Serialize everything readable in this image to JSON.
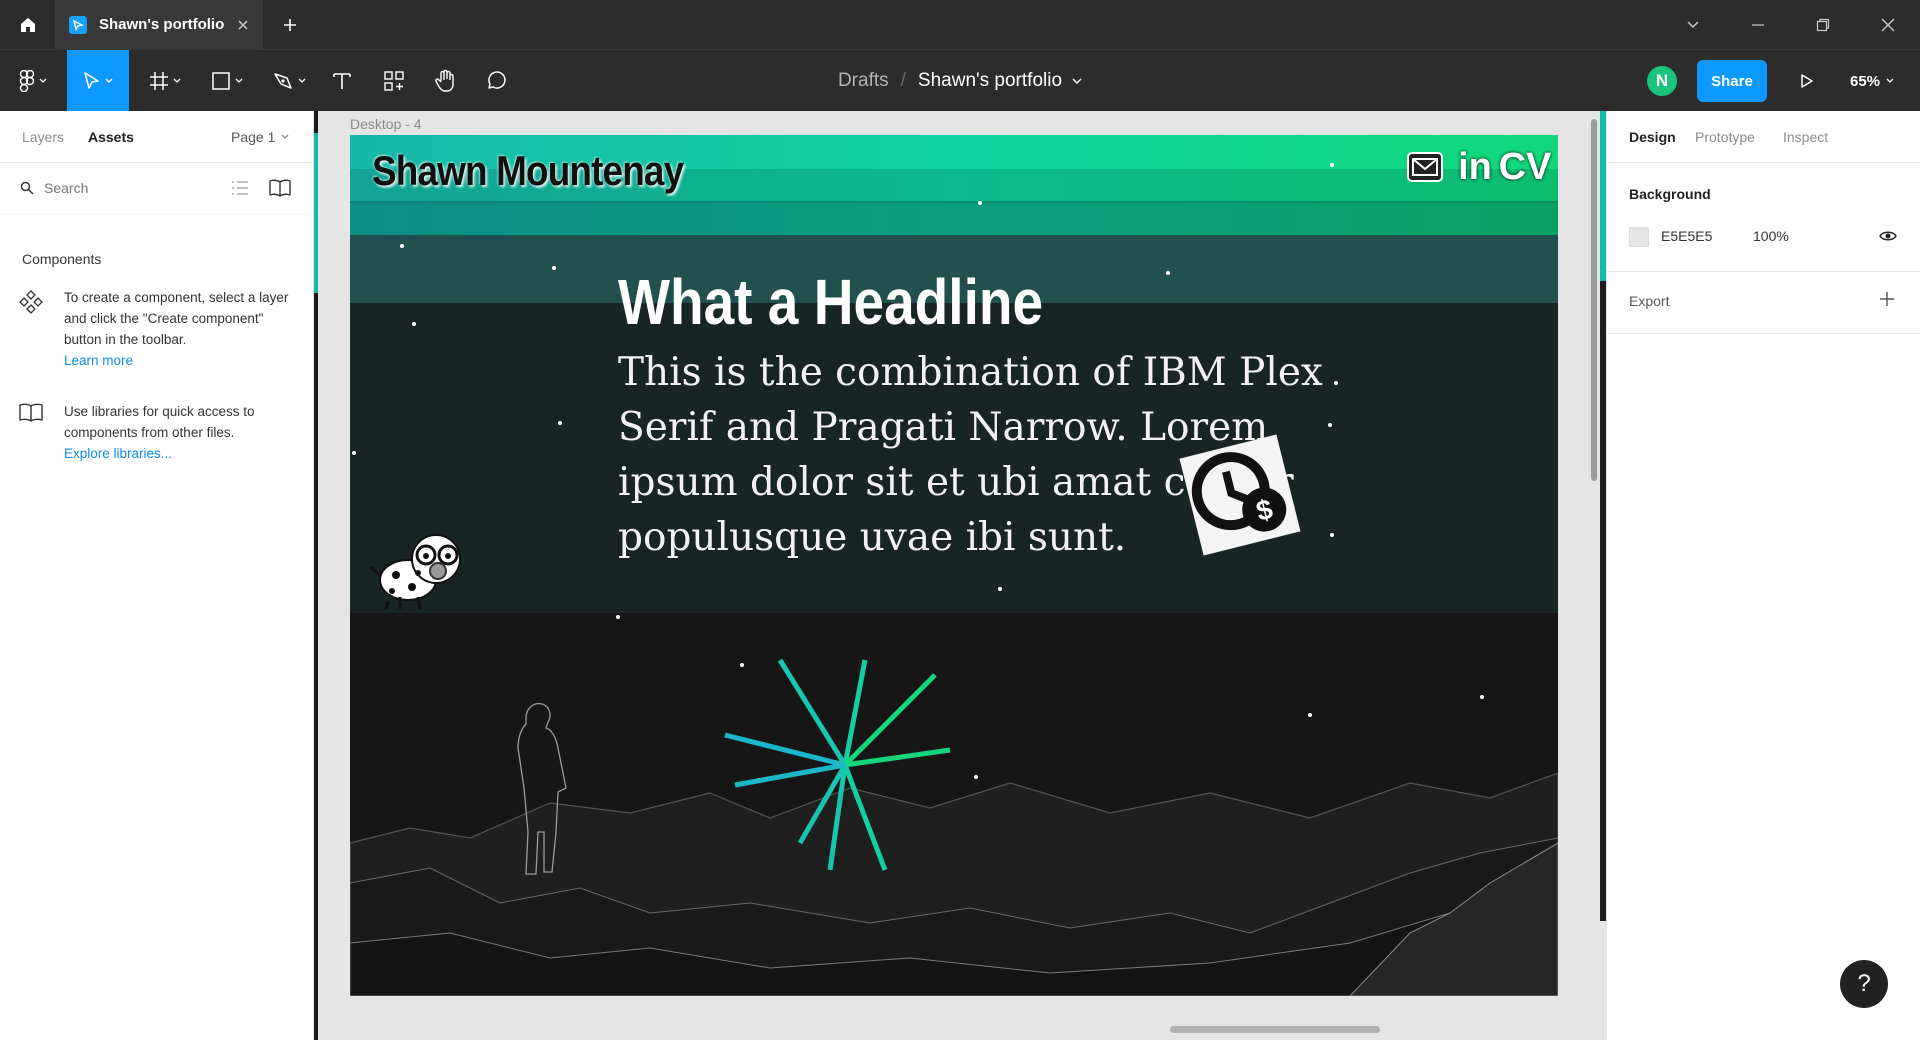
{
  "titlebar": {
    "tab_title": "Shawn's portfolio"
  },
  "toolbar": {
    "breadcrumb_folder": "Drafts",
    "breadcrumb_sep": "/",
    "breadcrumb_file": "Shawn's portfolio",
    "avatar_initial": "N",
    "share_label": "Share",
    "zoom_label": "65%"
  },
  "left_panel": {
    "tabs": [
      "Layers",
      "Assets"
    ],
    "active_tab": "Assets",
    "page_selector": "Page 1",
    "search_placeholder": "Search",
    "components_heading": "Components",
    "create_component_text": "To create a component, select a layer and click the \"Create component\" button in the toolbar.",
    "learn_more": "Learn more",
    "libraries_text": "Use libraries for quick access to components from other files.",
    "explore_libraries": "Explore libraries..."
  },
  "canvas": {
    "frame_label": "Desktop - 4",
    "artboard": {
      "name": "Shawn Mountenay",
      "cv_label": "CV",
      "linkedin_label": "in",
      "headline": "What a Headline",
      "body": "This is the combination of IBM Plex Serif and Pragati Narrow. Lorem ipsum dolor sit et ubi amat caesar populusque uvae ibi sunt.",
      "colors": {
        "gradient_start": "#16b8a8",
        "gradient_end": "#10d878",
        "burst_teal": "#19c4b0",
        "burst_green": "#12d67a"
      }
    }
  },
  "right_panel": {
    "tabs": [
      "Design",
      "Prototype",
      "Inspect"
    ],
    "active_tab": "Design",
    "background_heading": "Background",
    "background_hex": "E5E5E5",
    "background_opacity": "100%",
    "export_heading": "Export"
  },
  "help_label": "?"
}
